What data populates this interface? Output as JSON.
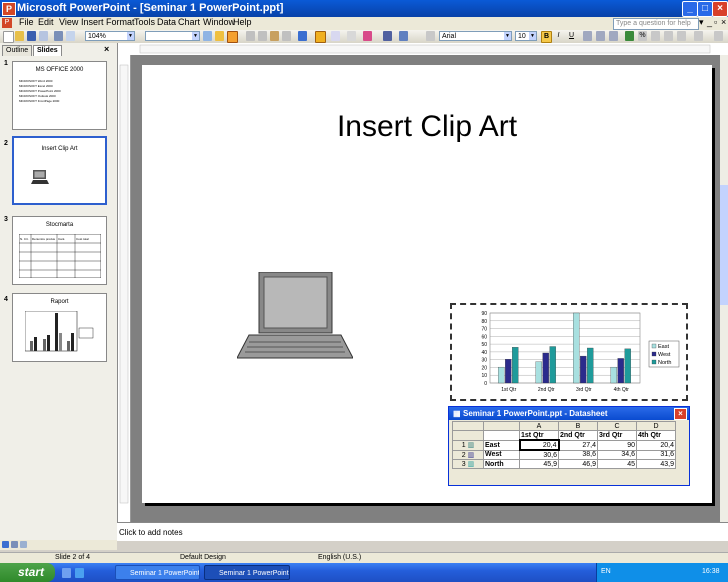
{
  "app": {
    "window_title": "Microsoft PowerPoint - [Seminar 1 PowerPoint.ppt]",
    "window_buttons": [
      "_",
      "□",
      "×"
    ]
  },
  "menubar": {
    "items": [
      "File",
      "Edit",
      "View",
      "Insert",
      "Format",
      "Tools",
      "Data",
      "Chart",
      "Window",
      "Help"
    ],
    "ask_placeholder": "Type a question for help"
  },
  "toolbar": {
    "zoom": "104%",
    "font_name": "Arial",
    "font_size": "10",
    "bold": "B",
    "italic": "I",
    "underline": "U"
  },
  "leftpane": {
    "tabs": [
      "Outline",
      "Slides"
    ],
    "close": "×",
    "slides": [
      {
        "number": "1",
        "title": "MS OFFICE 2000",
        "bullets": [
          "MICROSOFT Word 2000",
          "MICROSOFT Excel 2000",
          "MICROSOFT PowerPoint 2000",
          "MICROSOFT Outlook 2000",
          "MICROSOFT FrontPage 2000"
        ]
      },
      {
        "number": "2",
        "title": "Insert Clip Art"
      },
      {
        "number": "3",
        "title": "Stocmarta",
        "table_header": [
          "N. Crt.",
          "Denumire produs",
          "Cant.",
          "Cost total"
        ]
      },
      {
        "number": "4",
        "title": "Raport"
      }
    ]
  },
  "slide": {
    "title": "Insert Clip Art",
    "notes_placeholder": "Click to add notes"
  },
  "chart_data": {
    "type": "bar",
    "categories": [
      "1st Qtr",
      "2nd Qtr",
      "3rd Qtr",
      "4th Qtr"
    ],
    "series": [
      {
        "name": "East",
        "values": [
          20.4,
          27.4,
          90,
          20.4
        ]
      },
      {
        "name": "West",
        "values": [
          30.6,
          38.6,
          34.6,
          31.6
        ]
      },
      {
        "name": "North",
        "values": [
          45.9,
          46.9,
          45,
          43.9
        ]
      }
    ],
    "ylim": [
      0,
      90
    ],
    "yticks": [
      0,
      10,
      20,
      30,
      40,
      50,
      60,
      70,
      80,
      90
    ],
    "legend": "right",
    "grid": true,
    "colors": {
      "East": "#a8e0e0",
      "West": "#2b2b8c",
      "North": "#1f9b9b"
    }
  },
  "datasheet": {
    "title": "Seminar 1 PowerPoint.ppt - Datasheet",
    "columns": [
      "A",
      "B",
      "C",
      "D"
    ],
    "col_labels": [
      "1st Qtr",
      "2nd Qtr",
      "3rd Qtr",
      "4th Qtr"
    ],
    "rows": [
      {
        "num": "1",
        "label": "East",
        "values": [
          "20,4",
          "27,4",
          "90",
          "20,4"
        ]
      },
      {
        "num": "2",
        "label": "West",
        "values": [
          "30,6",
          "38,6",
          "34,6",
          "31,6"
        ]
      },
      {
        "num": "3",
        "label": "North",
        "values": [
          "45,9",
          "46,9",
          "45",
          "43,9"
        ]
      }
    ]
  },
  "statusbar": {
    "slide": "Slide 2 of 4",
    "design": "Default Design",
    "language": "English (U.S.)"
  },
  "taskbar": {
    "start": "start",
    "items": [
      "Seminar 1 PowerPoint...",
      "Seminar 1 PowerPoint...."
    ],
    "tray_lang": "EN",
    "clock": "16:38"
  }
}
